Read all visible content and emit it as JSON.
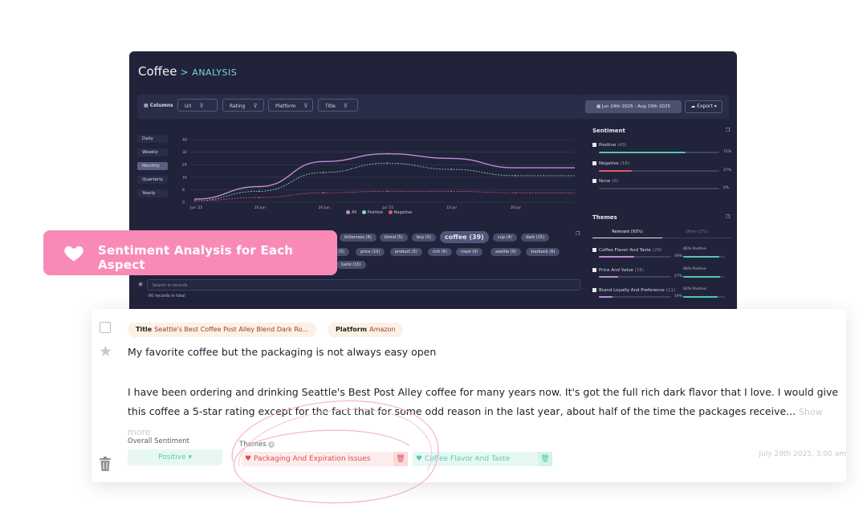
{
  "dashboard": {
    "title": "Coffee",
    "breadcrumb_sep": ">",
    "subtitle": "ANALYSIS",
    "toolbar": {
      "columns_label": "Columns",
      "filters": [
        "Url",
        "Rating",
        "Platform",
        "Title"
      ]
    },
    "date_range": "Jun 24th 2025 - Aug 19th 2025",
    "export_label": "Export",
    "granularity": [
      "Daily",
      "Weekly",
      "Monthly",
      "Quarterly",
      "Yearly"
    ],
    "active_granularity": "Monthly",
    "legend": {
      "all": "All",
      "positive": "Positive",
      "negative": "Negative"
    },
    "y_ticks": [
      "40",
      "32",
      "24",
      "16",
      "8",
      "0"
    ],
    "x_ticks": [
      "Jun '25",
      "10 Jun",
      "20 Jun",
      "Jul '25",
      "10 Jul",
      "20 Jul"
    ],
    "tags_row1": [
      "bitterness (4)",
      "blend (5)",
      "buy (5)",
      "coffee (39)",
      "cup (4)",
      "dark (15)"
    ],
    "tags_row2": [
      "(5)",
      "price (10)",
      "product (5)",
      "rich (6)",
      "roast (9)",
      "seattle (9)",
      "starbuck (6)"
    ],
    "tags_row3": [
      "taste (15)"
    ],
    "search_placeholder": "Search in records",
    "records_total": "60 records in total",
    "sentiment": {
      "heading": "Sentiment",
      "items": [
        {
          "label": "Positive",
          "count": "(43)",
          "pct": "72%",
          "frac": 0.72,
          "color": "#4fc7b0"
        },
        {
          "label": "Negative",
          "count": "(16)",
          "pct": "27%",
          "frac": 0.27,
          "color": "#e0566a"
        },
        {
          "label": "None",
          "count": "(0)",
          "pct": "0%",
          "frac": 0.0,
          "color": "#8e91a8"
        }
      ]
    },
    "themes": {
      "heading": "Themes",
      "tab_relevant": "Relevant (93%)",
      "tab_other": "Other (2%)",
      "items": [
        {
          "label": "Coffee Flavor And Taste",
          "count": "(29)",
          "pct": "49%",
          "pos": "86% Positive"
        },
        {
          "label": "Price And Value",
          "count": "(16)",
          "pct": "27%",
          "pos": "88% Positive"
        },
        {
          "label": "Brand Loyalty And Preference",
          "count": "(11)",
          "pct": "19%",
          "pos": "82% Positive"
        }
      ]
    }
  },
  "chart_data": {
    "type": "line",
    "x": [
      "Jun '25",
      "10 Jun",
      "20 Jun",
      "Jul '25",
      "10 Jul",
      "20 Jul"
    ],
    "ylim": [
      0,
      40
    ],
    "series": [
      {
        "name": "All",
        "color": "#c08ad8",
        "values": [
          2,
          10,
          26,
          31,
          28,
          22
        ]
      },
      {
        "name": "Positive",
        "color": "#8ed7c8",
        "values": [
          1,
          7,
          19,
          25,
          21,
          17
        ]
      },
      {
        "name": "Negative",
        "color": "#e0566a",
        "values": [
          1,
          3,
          6,
          7,
          7,
          6
        ]
      }
    ]
  },
  "banner": {
    "text": "Sentiment Analysis for Each Aspect"
  },
  "review": {
    "title_label": "Title",
    "title_value": "Seattle's Best Coffee Post Alley Blend Dark Ro...",
    "platform_label": "Platform",
    "platform_value": "Amazon",
    "headline": "My favorite coffee but the packaging is not always easy open",
    "body": "I have been ordering and drinking Seattle's Best Post Alley coffee for many years now. It's got the full rich dark flavor that I love. I would give this coffee a 5-star rating except for the fact that for some odd reason in the last year, about half of the time the packages receive...",
    "show_more": "Show more",
    "overall_sentiment_label": "Overall Sentiment",
    "overall_sentiment_value": "Positive",
    "themes_label": "Themes",
    "theme_negative": "Packaging And Expiration Issues",
    "theme_positive": "Coffee Flavor And Taste",
    "date": "July 29th 2025, 3:00 am",
    "colors": {
      "negative": "#d8505a",
      "positive": "#5ac7b4",
      "banner": "#f98ab8"
    }
  }
}
